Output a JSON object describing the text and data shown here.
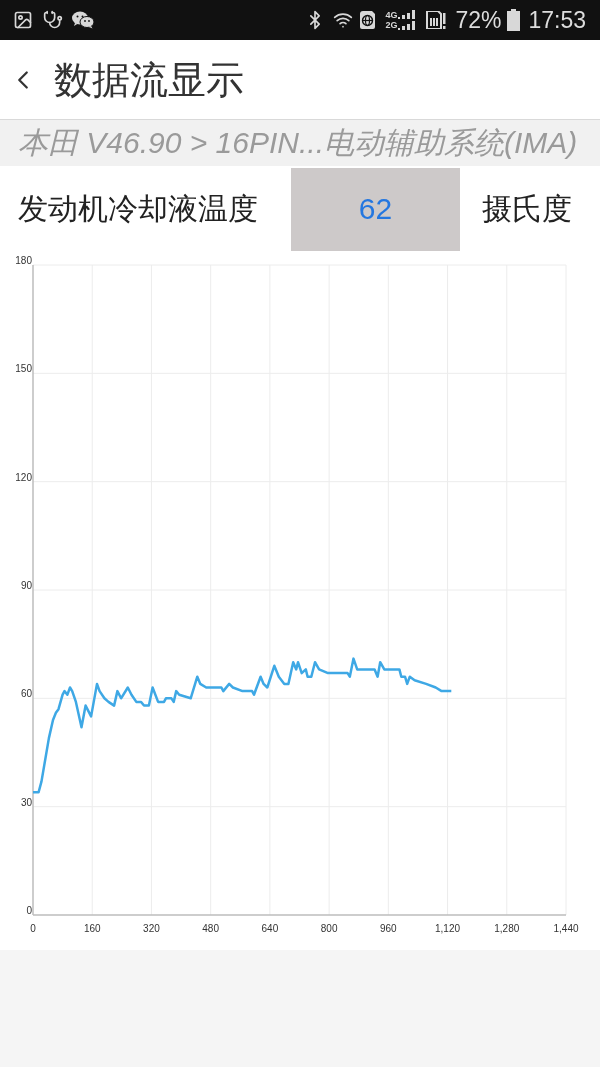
{
  "status_bar": {
    "network_types": [
      "4G",
      "2G"
    ],
    "battery": "72%",
    "time": "17:53"
  },
  "header": {
    "title": "数据流显示"
  },
  "breadcrumb": "本田 V46.90 > 16PIN...电动辅助系统(IMA)",
  "reading": {
    "label": "发动机冷却液温度",
    "value": "62",
    "unit": "摄氏度"
  },
  "chart": {
    "chart_data": {
      "type": "line",
      "grid": true,
      "x": [
        0,
        15,
        23,
        33,
        43,
        54,
        62,
        69,
        80,
        85,
        93,
        100,
        106,
        116,
        131,
        142,
        157,
        173,
        180,
        193,
        204,
        219,
        228,
        238,
        256,
        266,
        279,
        292,
        300,
        313,
        323,
        338,
        354,
        359,
        374,
        380,
        387,
        395,
        426,
        444,
        452,
        468,
        509,
        514,
        530,
        540,
        566,
        592,
        597,
        615,
        623,
        633,
        652,
        664,
        679,
        690,
        703,
        711,
        716,
        726,
        737,
        742,
        752,
        762,
        773,
        797,
        850,
        856,
        866,
        876,
        923,
        931,
        938,
        949,
        990,
        995,
        1005,
        1011,
        1018,
        1031,
        1062,
        1088,
        1104,
        1130
      ],
      "series": [
        {
          "color": "#3ea8e5",
          "values": [
            34,
            34,
            37,
            43,
            49,
            54,
            56,
            57,
            61,
            62,
            61,
            63,
            62,
            59,
            52,
            58,
            55,
            64,
            62,
            60,
            59,
            58,
            62,
            60,
            63,
            61,
            59,
            59,
            58,
            58,
            63,
            59,
            59,
            60,
            60,
            59,
            62,
            61,
            60,
            66,
            64,
            63,
            63,
            62,
            64,
            63,
            62,
            62,
            61,
            66,
            64,
            63,
            69,
            66,
            64,
            64,
            70,
            68,
            70,
            67,
            68,
            66,
            66,
            70,
            68,
            67,
            67,
            66,
            71,
            68,
            68,
            66,
            70,
            68,
            68,
            66,
            66,
            64,
            66,
            65,
            64,
            63,
            62,
            62
          ]
        }
      ],
      "xlim": [
        0,
        1440
      ],
      "ylim": [
        0,
        180
      ],
      "xticks": [
        0,
        160,
        320,
        480,
        640,
        800,
        960,
        {
          "value": 1120,
          "label": "1,120"
        },
        {
          "value": 1280,
          "label": "1,280"
        },
        {
          "value": 1440,
          "label": "1,440"
        }
      ],
      "yticks": [
        0,
        30,
        60,
        90,
        120,
        150,
        180
      ]
    }
  }
}
